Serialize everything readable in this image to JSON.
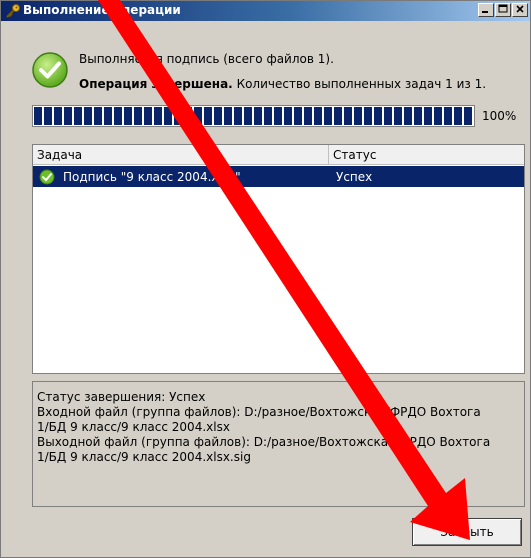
{
  "window": {
    "title": "Выполнение операции",
    "controls": [
      "minimize",
      "maximize",
      "close"
    ]
  },
  "status": {
    "line1": "Выполняется подпись (всего файлов 1).",
    "line2_bold": "Операция завершена.",
    "line2_rest": "Количество выполненных задач 1 из 1."
  },
  "progress": {
    "percent": 100,
    "label": "100%"
  },
  "table": {
    "columns": [
      "Задача",
      "Статус"
    ],
    "rows": [
      {
        "task": "Подпись \"9 класс 2004.xlsx\"",
        "status": "Успех",
        "selected": true
      }
    ]
  },
  "details": {
    "lines": [
      "Статус завершения: Успех",
      "Входной файл (группа файлов): D:/разное/Вохтожская/ФРДО Вохтога",
      "1/БД 9 класс/9 класс 2004.xlsx",
      "Выходной файл (группа файлов): D:/разное/Вохтожская/ФРДО Вохтога",
      "1/БД 9 класс/9 класс 2004.xlsx.sig"
    ]
  },
  "buttons": {
    "close_label": "Закрыть"
  },
  "colors": {
    "annotation_arrow": "#ff0000",
    "selection": "#0a246a",
    "success_icon": "#6cbf2a"
  },
  "icons": {
    "title": "key-icon",
    "status": "success-check-icon",
    "row": "success-check-icon"
  }
}
